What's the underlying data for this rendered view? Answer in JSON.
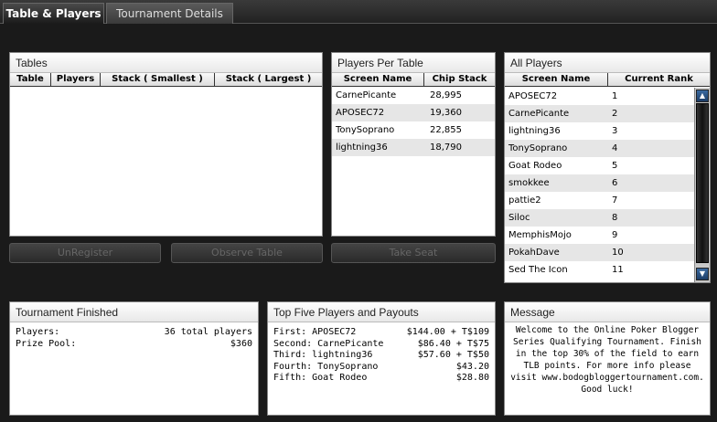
{
  "tabs": [
    {
      "label": "Table & Players",
      "active": true
    },
    {
      "label": "Tournament Details",
      "active": false
    }
  ],
  "tables_panel": {
    "title": "Tables",
    "columns": [
      "Table",
      "Players",
      "Stack ( Smallest )",
      "Stack ( Largest )"
    ]
  },
  "players_per_table": {
    "title": "Players Per Table",
    "columns": [
      "Screen Name",
      "Chip Stack"
    ],
    "rows": [
      {
        "name": "CarnePicante",
        "chips": "28,995"
      },
      {
        "name": "APOSEC72",
        "chips": "19,360"
      },
      {
        "name": "TonySoprano",
        "chips": "22,855"
      },
      {
        "name": "lightning36",
        "chips": "18,790"
      }
    ]
  },
  "all_players": {
    "title": "All Players",
    "columns": [
      "Screen Name",
      "Current Rank"
    ],
    "rows": [
      {
        "name": "APOSEC72",
        "rank": "1"
      },
      {
        "name": "CarnePicante",
        "rank": "2"
      },
      {
        "name": "lightning36",
        "rank": "3"
      },
      {
        "name": "TonySoprano",
        "rank": "4"
      },
      {
        "name": "Goat Rodeo",
        "rank": "5"
      },
      {
        "name": "smokkee",
        "rank": "6"
      },
      {
        "name": "pattie2",
        "rank": "7"
      },
      {
        "name": "Siloc",
        "rank": "8"
      },
      {
        "name": "MemphisMojo",
        "rank": "9"
      },
      {
        "name": "PokahDave",
        "rank": "10"
      },
      {
        "name": "Sed The Icon",
        "rank": "11"
      }
    ]
  },
  "buttons": {
    "unregister": "UnRegister",
    "observe": "Observe Table",
    "take_seat": "Take Seat"
  },
  "tournament_finished": {
    "title": "Tournament Finished",
    "players_label": "Players:",
    "players_value": "36 total players",
    "prize_label": "Prize Pool:",
    "prize_value": "$360"
  },
  "top_five": {
    "title": "Top Five Players and Payouts",
    "rows": [
      {
        "place": "First: APOSEC72",
        "payout": "$144.00 + T$109"
      },
      {
        "place": "Second: CarnePicante",
        "payout": "$86.40 + T$75"
      },
      {
        "place": "Third: lightning36",
        "payout": "$57.60 + T$50"
      },
      {
        "place": "Fourth: TonySoprano",
        "payout": "$43.20"
      },
      {
        "place": "Fifth: Goat Rodeo",
        "payout": "$28.80"
      }
    ]
  },
  "message": {
    "title": "Message",
    "text": "Welcome to the Online Poker Blogger Series Qualifying Tournament. Finish in the top 30% of the field to earn TLB points. For more info please visit www.bodogbloggertournament.com. Good luck!"
  }
}
